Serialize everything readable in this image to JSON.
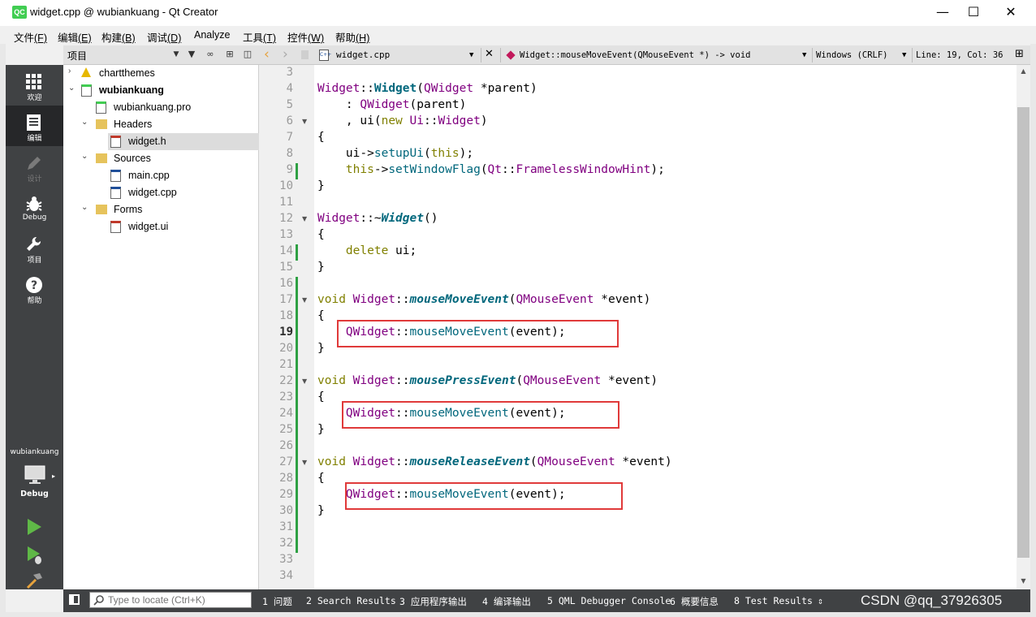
{
  "window": {
    "logo": "QC",
    "title": "widget.cpp @ wubiankuang - Qt Creator",
    "minimize": "—",
    "maximize": "☐",
    "close": "✕"
  },
  "menu": [
    {
      "label": "文件",
      "key": "(F)"
    },
    {
      "label": "编辑",
      "key": "(E)"
    },
    {
      "label": "构建",
      "key": "(B)"
    },
    {
      "label": "调试",
      "key": "(D)"
    },
    {
      "label": "Analyze",
      "key": ""
    },
    {
      "label": "工具",
      "key": "(T)"
    },
    {
      "label": "控件",
      "key": "(W)"
    },
    {
      "label": "帮助",
      "key": "(H)"
    }
  ],
  "modes": [
    {
      "label": "欢迎",
      "icon": "grid-icon",
      "state": "normal"
    },
    {
      "label": "编辑",
      "icon": "document-icon",
      "state": "active"
    },
    {
      "label": "设计",
      "icon": "pencil-icon",
      "state": "disabled"
    },
    {
      "label": "Debug",
      "icon": "bug-icon",
      "state": "normal"
    },
    {
      "label": "项目",
      "icon": "wrench-icon",
      "state": "normal"
    },
    {
      "label": "帮助",
      "icon": "help-icon",
      "state": "normal"
    }
  ],
  "kit": {
    "project": "wubiankuang",
    "config": "Debug",
    "icon": "monitor-icon"
  },
  "run_buttons": [
    "run-icon",
    "debug-run-icon",
    "build-hammer-icon"
  ],
  "tree_header": {
    "title": "项目"
  },
  "tree": [
    {
      "label": "chartthemes",
      "icon": "warning-icon",
      "arrow": "›",
      "level": 0,
      "bold": false
    },
    {
      "label": "wubiankuang",
      "icon": "qt-project-icon",
      "arrow": "⌄",
      "level": 0,
      "bold": true
    },
    {
      "label": "wubiankuang.pro",
      "icon": "pro-file-icon",
      "arrow": "",
      "level": 1,
      "bold": false
    },
    {
      "label": "Headers",
      "icon": "headers-folder-icon",
      "arrow": "⌄",
      "level": 1,
      "bold": false
    },
    {
      "label": "widget.h",
      "icon": "header-file-icon",
      "arrow": "",
      "level": 2,
      "bold": false,
      "selected": true
    },
    {
      "label": "Sources",
      "icon": "sources-folder-icon",
      "arrow": "⌄",
      "level": 1,
      "bold": false
    },
    {
      "label": "main.cpp",
      "icon": "cpp-file-icon",
      "arrow": "",
      "level": 2,
      "bold": false
    },
    {
      "label": "widget.cpp",
      "icon": "cpp-file-icon",
      "arrow": "",
      "level": 2,
      "bold": false
    },
    {
      "label": "Forms",
      "icon": "forms-folder-icon",
      "arrow": "⌄",
      "level": 1,
      "bold": false
    },
    {
      "label": "widget.ui",
      "icon": "ui-file-icon",
      "arrow": "",
      "level": 2,
      "bold": false
    }
  ],
  "editor_toolbar": {
    "back": "‹",
    "forward": "›",
    "file": "widget.cpp",
    "symbol": "Widget::mouseMoveEvent(QMouseEvent *) -> void",
    "encoding": "Windows (CRLF)",
    "position": "Line: 19, Col: 36"
  },
  "code": {
    "first_line": 3,
    "current_line": 19,
    "lines": [
      [],
      [
        [
          "ty",
          "Widget"
        ],
        [
          "",
          "::"
        ],
        [
          "fnd",
          "Widget"
        ],
        [
          "",
          "("
        ],
        [
          "ty",
          "QWidget"
        ],
        [
          "",
          " *"
        ],
        [
          "",
          "parent"
        ],
        [
          "",
          ")"
        ]
      ],
      [
        [
          "",
          "    : "
        ],
        [
          "ty",
          "QWidget"
        ],
        [
          "",
          "("
        ],
        [
          "",
          "parent"
        ],
        [
          "",
          ")"
        ]
      ],
      [
        [
          "",
          "    , "
        ],
        [
          "",
          "ui"
        ],
        [
          "",
          "("
        ],
        [
          "kw",
          "new"
        ],
        [
          "",
          " "
        ],
        [
          "ty",
          "Ui"
        ],
        [
          "",
          "::"
        ],
        [
          "ty",
          "Widget"
        ],
        [
          "",
          ")"
        ]
      ],
      [
        [
          "",
          "{"
        ]
      ],
      [
        [
          "",
          "    "
        ],
        [
          "",
          "ui"
        ],
        [
          "",
          "->"
        ],
        [
          "fn",
          "setupUi"
        ],
        [
          "",
          "("
        ],
        [
          "kw",
          "this"
        ],
        [
          "",
          ");"
        ]
      ],
      [
        [
          "",
          "    "
        ],
        [
          "kw",
          "this"
        ],
        [
          "",
          "->"
        ],
        [
          "fn",
          "setWindowFlag"
        ],
        [
          "",
          "("
        ],
        [
          "ty",
          "Qt"
        ],
        [
          "",
          "::"
        ],
        [
          "ty",
          "FramelessWindowHint"
        ],
        [
          "",
          ");"
        ]
      ],
      [
        [
          "",
          "}"
        ]
      ],
      [],
      [
        [
          "ty",
          "Widget"
        ],
        [
          "",
          "::~"
        ],
        [
          "fni",
          "Widget"
        ],
        [
          "",
          "()"
        ]
      ],
      [
        [
          "",
          "{"
        ]
      ],
      [
        [
          "",
          "    "
        ],
        [
          "kw",
          "delete"
        ],
        [
          "",
          " "
        ],
        [
          "",
          "ui"
        ],
        [
          "",
          ";"
        ]
      ],
      [
        [
          "",
          "}"
        ]
      ],
      [],
      [
        [
          "kw",
          "void"
        ],
        [
          "",
          " "
        ],
        [
          "ty",
          "Widget"
        ],
        [
          "",
          "::"
        ],
        [
          "fni",
          "mouseMoveEvent"
        ],
        [
          "",
          "("
        ],
        [
          "ty",
          "QMouseEvent"
        ],
        [
          "",
          " *"
        ],
        [
          "",
          "event"
        ],
        [
          "",
          ")"
        ]
      ],
      [
        [
          "",
          "{"
        ]
      ],
      [
        [
          "",
          "    "
        ],
        [
          "ty",
          "QWidget"
        ],
        [
          "",
          "::"
        ],
        [
          "fn",
          "mouseMoveEvent"
        ],
        [
          "",
          "("
        ],
        [
          "",
          "event"
        ],
        [
          "",
          ");"
        ]
      ],
      [
        [
          "",
          "}"
        ]
      ],
      [],
      [
        [
          "kw",
          "void"
        ],
        [
          "",
          " "
        ],
        [
          "ty",
          "Widget"
        ],
        [
          "",
          "::"
        ],
        [
          "fni",
          "mousePressEvent"
        ],
        [
          "",
          "("
        ],
        [
          "ty",
          "QMouseEvent"
        ],
        [
          "",
          " *"
        ],
        [
          "",
          "event"
        ],
        [
          "",
          ")"
        ]
      ],
      [
        [
          "",
          "{"
        ]
      ],
      [
        [
          "",
          "    "
        ],
        [
          "ty",
          "QWidget"
        ],
        [
          "",
          "::"
        ],
        [
          "fn",
          "mouseMoveEvent"
        ],
        [
          "",
          "("
        ],
        [
          "",
          "event"
        ],
        [
          "",
          ");"
        ]
      ],
      [
        [
          "",
          "}"
        ]
      ],
      [],
      [
        [
          "kw",
          "void"
        ],
        [
          "",
          " "
        ],
        [
          "ty",
          "Widget"
        ],
        [
          "",
          "::"
        ],
        [
          "fni",
          "mouseReleaseEvent"
        ],
        [
          "",
          "("
        ],
        [
          "ty",
          "QMouseEvent"
        ],
        [
          "",
          " *"
        ],
        [
          "",
          "event"
        ],
        [
          "",
          ")"
        ]
      ],
      [
        [
          "",
          "{"
        ]
      ],
      [
        [
          "",
          "    "
        ],
        [
          "ty",
          "QWidget"
        ],
        [
          "",
          "::"
        ],
        [
          "fn",
          "mouseMoveEvent"
        ],
        [
          "",
          "("
        ],
        [
          "",
          "event"
        ],
        [
          "",
          ");"
        ]
      ],
      [
        [
          "",
          "}"
        ]
      ],
      [],
      [],
      [],
      []
    ],
    "fold_lines": [
      6,
      12,
      17,
      22,
      27
    ],
    "modified_ranges": [
      [
        9,
        9
      ],
      [
        14,
        14
      ],
      [
        16,
        32
      ]
    ],
    "highlight_lines": [
      19,
      24,
      29
    ]
  },
  "statusbar": {
    "locator_placeholder": "Type to locate (Ctrl+K)",
    "tabs": [
      "1 问题",
      "2 Search Results",
      "3 应用程序输出",
      "4 编译输出",
      "5 QML Debugger Console",
      "6 概要信息",
      "8 Test Results"
    ],
    "more": "⇕"
  },
  "watermark": "CSDN @qq_37926305"
}
